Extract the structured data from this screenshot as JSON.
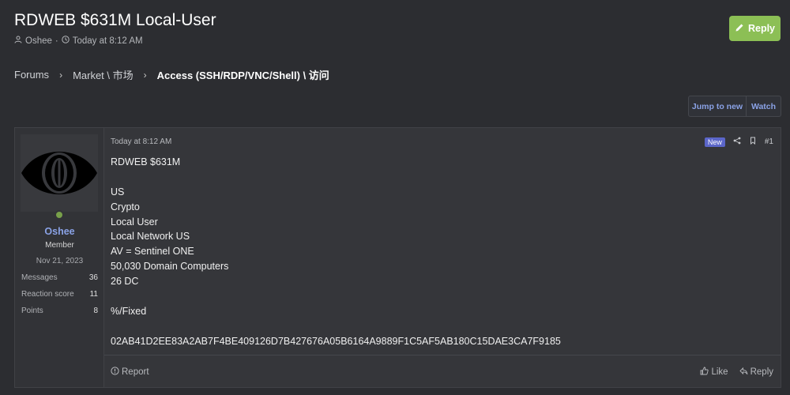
{
  "thread": {
    "title": "RDWEB $631M Local-User",
    "author": "Oshee",
    "meta_sep": "·",
    "time": "Today at 8:12 AM",
    "reply_label": "Reply"
  },
  "breadcrumb": {
    "items": [
      "Forums",
      "Market \\ 市场",
      "Access (SSH/RDP/VNC/Shell) \\ 访问"
    ],
    "separator": "›"
  },
  "actions": {
    "jump_label": "Jump to new",
    "watch_label": "Watch"
  },
  "post": {
    "date": "Today at 8:12 AM",
    "new_badge": "New",
    "number": "#1",
    "lines": [
      "RDWEB $631M",
      "",
      "US",
      "Crypto",
      "Local User",
      "Local Network US",
      "AV = Sentinel ONE",
      "50,030 Domain Computers",
      "26 DC",
      "",
      "%/Fixed",
      "",
      "02AB41D2EE83A2AB7F4BE409126D7B427676A05B6164A9889F1C5AF5AB180C15DAE3CA7F9185"
    ],
    "report_label": "Report",
    "like_label": "Like",
    "reply_label": "Reply"
  },
  "user": {
    "name": "Oshee",
    "title": "Member",
    "joined": "Nov 21, 2023",
    "stats": [
      {
        "label": "Messages",
        "value": "36"
      },
      {
        "label": "Reaction score",
        "value": "11"
      },
      {
        "label": "Points",
        "value": "8"
      }
    ],
    "avatar_icon": "eye-icon",
    "online_color": "#78a04a"
  },
  "colors": {
    "accent": "#8aa2e6",
    "reply_button": "#8cbf55",
    "badge": "#5b66c9",
    "background": "#2c2d31"
  }
}
